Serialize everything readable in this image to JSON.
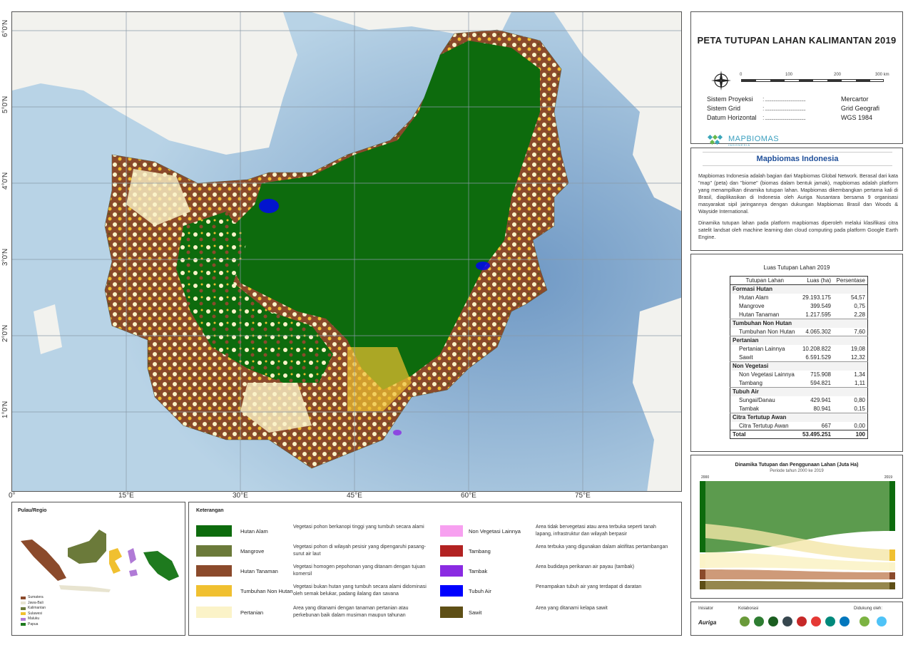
{
  "title": "PETA TUTUPAN LAHAN KALIMANTAN 2019",
  "scale_ticks": [
    "0",
    "100",
    "200",
    "300 km"
  ],
  "compass": {
    "n": "N",
    "s": "S",
    "e": "E",
    "w": "W"
  },
  "meta": [
    {
      "key": "Sistem Proyeksi",
      "value": "Mercartor"
    },
    {
      "key": "Sistem Grid",
      "value": "Grid Geografi"
    },
    {
      "key": "Datum Horizontal",
      "value": "WGS 1984"
    }
  ],
  "brand": "MAPBIOMAS",
  "brand_sub": "INDONESIA",
  "info_title": "Mapbiomas Indonesia",
  "info_p1": "Mapbiomas Indonesia adalah bagian dari Mapbiomas Global Network. Berasal dari kata \"map\" (peta) dan \"biome\" (biomas dalam bentuk jamak), mapbiomas adalah platform yang menampilkan dinamika tutupan lahan. Mapbiomas dikembangkan pertama kali di Brasil, diaplikasikan di Indonesia oleh Auriga Nusantara bersama 9 organisasi masyarakat sipil jaringannya dengan dukungan Mapbiomas Brasil dan Woods & Wayside International.",
  "info_p2": "Dinamika tutupan lahan pada platform mapbiomas diperoleh melalui klasifikasi citra satelit landsat oleh machine learning dan cloud computing pada platform Google Earth Engine.",
  "lat_labels": [
    "6°0'N",
    "5°0'N",
    "4°0'N",
    "3°0'N",
    "2°0'N",
    "1°0'N"
  ],
  "lon_labels": [
    "0°",
    "15°E",
    "30°E",
    "45°E",
    "60°E",
    "75°E"
  ],
  "table": {
    "title": "Luas Tutupan Lahan 2019",
    "headers": [
      "Tutupan Lahan",
      "Luas (ha)",
      "Persentase"
    ],
    "groups": [
      {
        "name": "Formasi Hutan",
        "items": [
          {
            "name": "Hutan Alam",
            "area": "29.193.175",
            "pct": "54,57"
          },
          {
            "name": "Mangrove",
            "area": "399.549",
            "pct": "0,75"
          },
          {
            "name": "Hutan Tanaman",
            "area": "1.217.595",
            "pct": "2,28"
          }
        ]
      },
      {
        "name": "Tumbuhan Non Hutan",
        "items": [
          {
            "name": "Tumbuhan Non Hutan",
            "area": "4.065.302",
            "pct": "7,60"
          }
        ]
      },
      {
        "name": "Pertanian",
        "items": [
          {
            "name": "Pertanian Lainnya",
            "area": "10.208.822",
            "pct": "19,08"
          },
          {
            "name": "Sawit",
            "area": "6.591.529",
            "pct": "12,32"
          }
        ]
      },
      {
        "name": "Non Vegetasi",
        "items": [
          {
            "name": "Non Vegetasi Lainnya",
            "area": "715.908",
            "pct": "1,34"
          },
          {
            "name": "Tambang",
            "area": "594.821",
            "pct": "1,11"
          }
        ]
      },
      {
        "name": "Tubuh Air",
        "items": [
          {
            "name": "Sungai/Danau",
            "area": "429.941",
            "pct": "0,80"
          },
          {
            "name": "Tambak",
            "area": "80.941",
            "pct": "0,15"
          }
        ]
      },
      {
        "name": "Citra Tertutup Awan",
        "items": [
          {
            "name": "Citra Tertutup Awan",
            "area": "667",
            "pct": "0,00"
          }
        ]
      }
    ],
    "total": {
      "name": "Total",
      "area": "53.495.251",
      "pct": "100"
    }
  },
  "sankey_title": "Dinamika Tutupan dan Penggunaan Lahan (Juta Ha)",
  "sankey_sub": "Periode tahun 2000 ke 2019",
  "sankey_years": [
    "2000",
    "2019"
  ],
  "logos": {
    "initiator": "Inisiator",
    "collab": "Kolaborasi",
    "support": "Didukung oleh:",
    "auriga": "Auriga"
  },
  "region": {
    "title": "Pulau/Regio",
    "items": [
      {
        "name": "Sumatera",
        "color": "#8b4a2b"
      },
      {
        "name": "Jawa-Bali",
        "color": "#e8e4d0"
      },
      {
        "name": "Kalimantan",
        "color": "#6b7a3a"
      },
      {
        "name": "Sulawesi",
        "color": "#f0c030"
      },
      {
        "name": "Maluku",
        "color": "#b07ad6"
      },
      {
        "name": "Papua",
        "color": "#1e7a1e"
      }
    ]
  },
  "legend": {
    "title": "Keterangan",
    "items": [
      {
        "name": "Hutan Alam",
        "color": "#0d6b0d",
        "desc": "Vegetasi pohon berkanopi tinggi yang tumbuh secara alami"
      },
      {
        "name": "Mangrove",
        "color": "#6b7a3a",
        "desc": "Vegetasi pohon di wilayah pesisir yang dipengaruhi pasang-surut air laut"
      },
      {
        "name": "Hutan Tanaman",
        "color": "#8b4a2b",
        "desc": "Vegetasi homogen pepohonan yang ditanam dengan tujuan komersil"
      },
      {
        "name": "Tumbuhan Non Hutan",
        "color": "#f0c030",
        "desc": "Vegetasi bukan hutan yang tumbuh secara alami didominasi oleh semak belukar, padang ilalang dan savana"
      },
      {
        "name": "Pertanian",
        "color": "#fbf3c8",
        "desc": "Area yang ditanami dengan tanaman pertanian atau perkebunan baik dalam musiman maupun tahunan"
      },
      {
        "name": "Non Vegetasi Lainnya",
        "color": "#f7a0f0",
        "desc": "Area tidak bervegetasi atau area terbuka seperti tanah lapang, infrastruktur dan wilayah berpasir"
      },
      {
        "name": "Tambang",
        "color": "#b22222",
        "desc": "Area terbuka yang digunakan dalam aktifitas pertambangan"
      },
      {
        "name": "Tambak",
        "color": "#8a2be2",
        "desc": "Area budidaya perikanan air payau (tambak)"
      },
      {
        "name": "Tubuh Air",
        "color": "#0000ff",
        "desc": "Penampakan tubuh air yang terdapat di daratan"
      },
      {
        "name": "Sawit",
        "color": "#5e4f16",
        "desc": "Area yang ditanami kelapa sawit"
      }
    ]
  },
  "colors": {
    "sea": "#b8d3e6",
    "sea_deep": "#7fa9cf",
    "land_neighbor": "#f0f0ec",
    "forest": "#0d6b0d"
  }
}
